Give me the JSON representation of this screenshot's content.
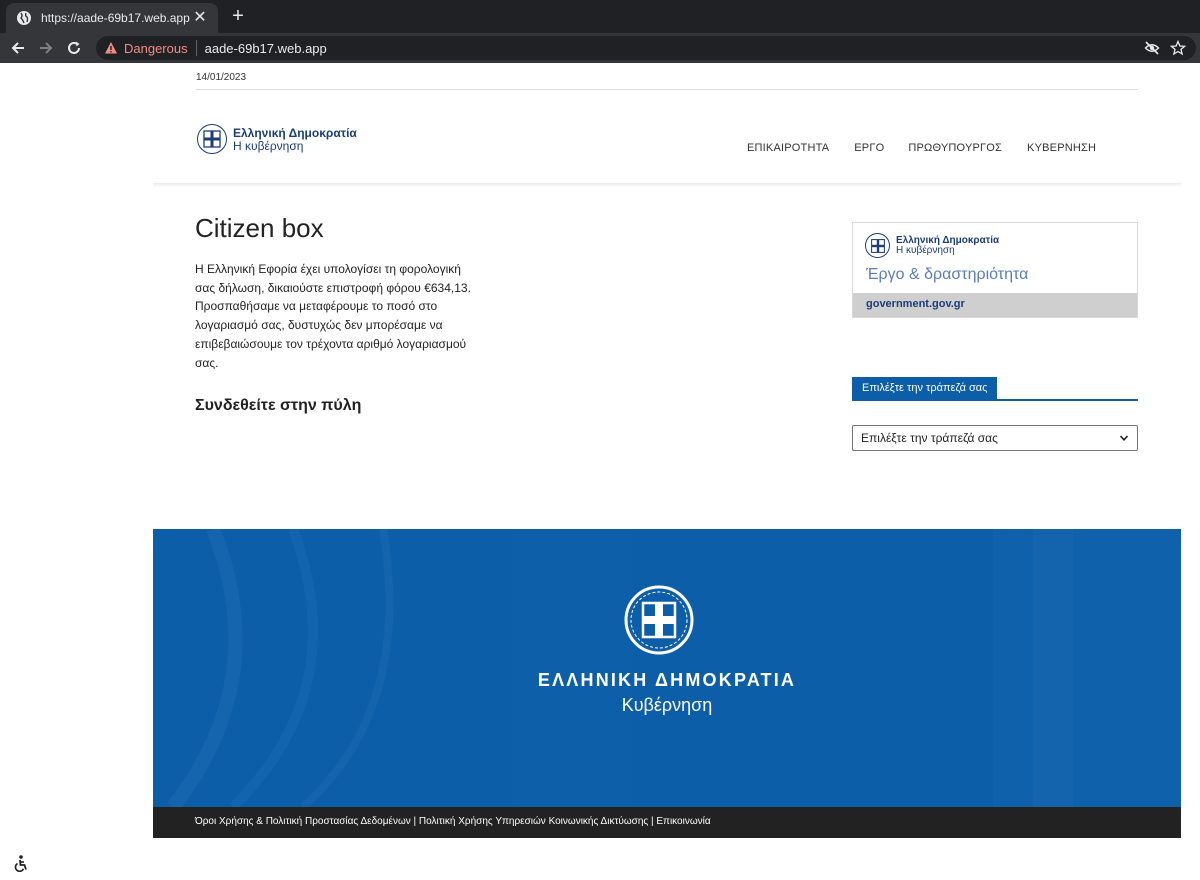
{
  "browser": {
    "tab_title": "https://aade-69b17.web.app",
    "tab_close": "✕",
    "new_tab": "+",
    "security_label": "Dangerous",
    "url": "aade-69b17.web.app",
    "colors": {
      "danger": "#f28b82",
      "chrome_dark": "#202124",
      "chrome_mid": "#35363a"
    }
  },
  "page": {
    "date": "14/01/2023",
    "logo": {
      "line1": "Ελληνική Δημοκρατία",
      "line2": "Η κυβέρνηση"
    },
    "nav": [
      "ΕΠΙΚΑΙΡΟΤΗΤΑ",
      "ΕΡΓΟ",
      "ΠΡΩΘΥΠΟΥΡΓΟΣ",
      "ΚΥΒΕΡΝΗΣΗ"
    ],
    "title": "Citizen box",
    "message": "Η Ελληνική Εφορία έχει υπολογίσει τη φορολογική σας δήλωση, δικαιούστε επιστροφή φόρου €634,13. Προσπαθήσαμε να μεταφέρουμε το ποσό στο λογαριασμό σας, δυστυχώς δεν μπορέσαμε να επιβεβαιώσουμε τον τρέχοντα αριθμό λογαριασμού σας.",
    "login_heading": "Συνδεθείτε στην πύλη",
    "card": {
      "logo_line1": "Ελληνική Δημοκρατία",
      "logo_line2": "Η κυβέρνηση",
      "title": "Έργο & δραστηριότητα",
      "footer_link": "government.gov.gr"
    },
    "bank": {
      "heading": "Επιλέξτε την τράπεζά σας",
      "select_value": "Επιλέξτε την τράπεζά σας"
    },
    "footer": {
      "line1": "ΕΛΛΗΝΙΚΗ ΔΗΜΟΚΡΑΤΙΑ",
      "line2": "Κυβέρνηση",
      "links": "Όροι Χρήσης & Πολιτική Προστασίας Δεδομένων | Πολιτική Χρήσης Υπηρεσιών Κοινωνικής Δικτύωσης | Επικοινωνία"
    },
    "colors": {
      "brand_blue": "#0d5ea8",
      "logo_navy": "#1b3d7a",
      "footer_bar": "#222222"
    },
    "icons": [
      "globe-icon",
      "warning-icon",
      "eye-off-icon",
      "star-icon",
      "chevron-down-icon",
      "accessibility-icon",
      "emblem-icon"
    ]
  }
}
